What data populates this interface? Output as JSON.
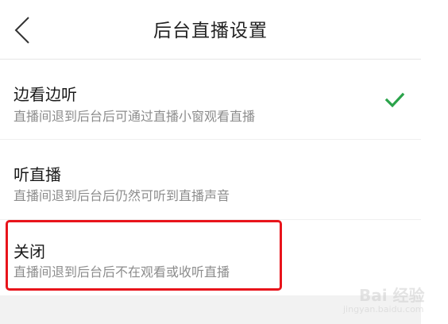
{
  "header": {
    "title": "后台直播设置",
    "back_icon": "chevron-left-icon"
  },
  "options": [
    {
      "title": "边看边听",
      "description": "直播间退到后台后可通过直播小窗观看直播",
      "selected": true
    },
    {
      "title": "听直播",
      "description": "直播间退到后台后仍然可听到直播声音",
      "selected": false
    },
    {
      "title": "关闭",
      "description": "直播间退到后台后不在观看或收听直播",
      "selected": false
    }
  ],
  "colors": {
    "check": "#2aa34a",
    "highlight": "#e8141b"
  },
  "watermark": {
    "text": "Bai 经验",
    "sub": "jingyan.baidu.com"
  }
}
